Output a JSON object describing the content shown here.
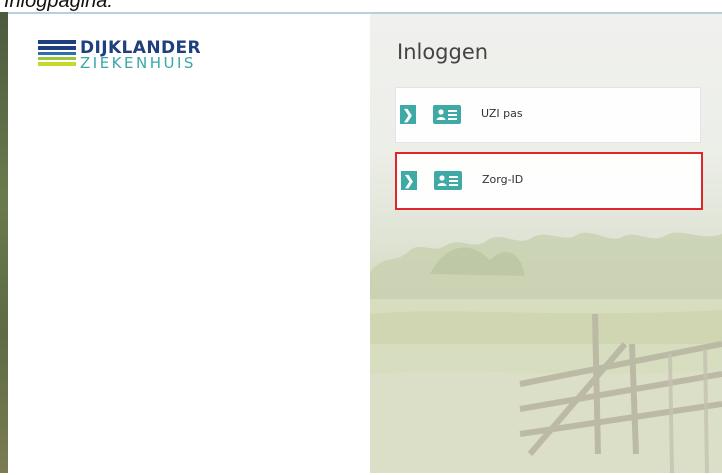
{
  "caption": "Inlogpagina:",
  "brand": {
    "name_top": "DIJKLANDER",
    "name_bottom": "ZIEKENHUIS"
  },
  "login": {
    "title": "Inloggen",
    "options": [
      {
        "label": "UZI pas",
        "selected": false
      },
      {
        "label": "Zorg-ID",
        "selected": true
      }
    ]
  },
  "colors": {
    "accent": "#3fa9a6",
    "brand_blue": "#1f3f7e",
    "highlight": "#e0262b"
  }
}
